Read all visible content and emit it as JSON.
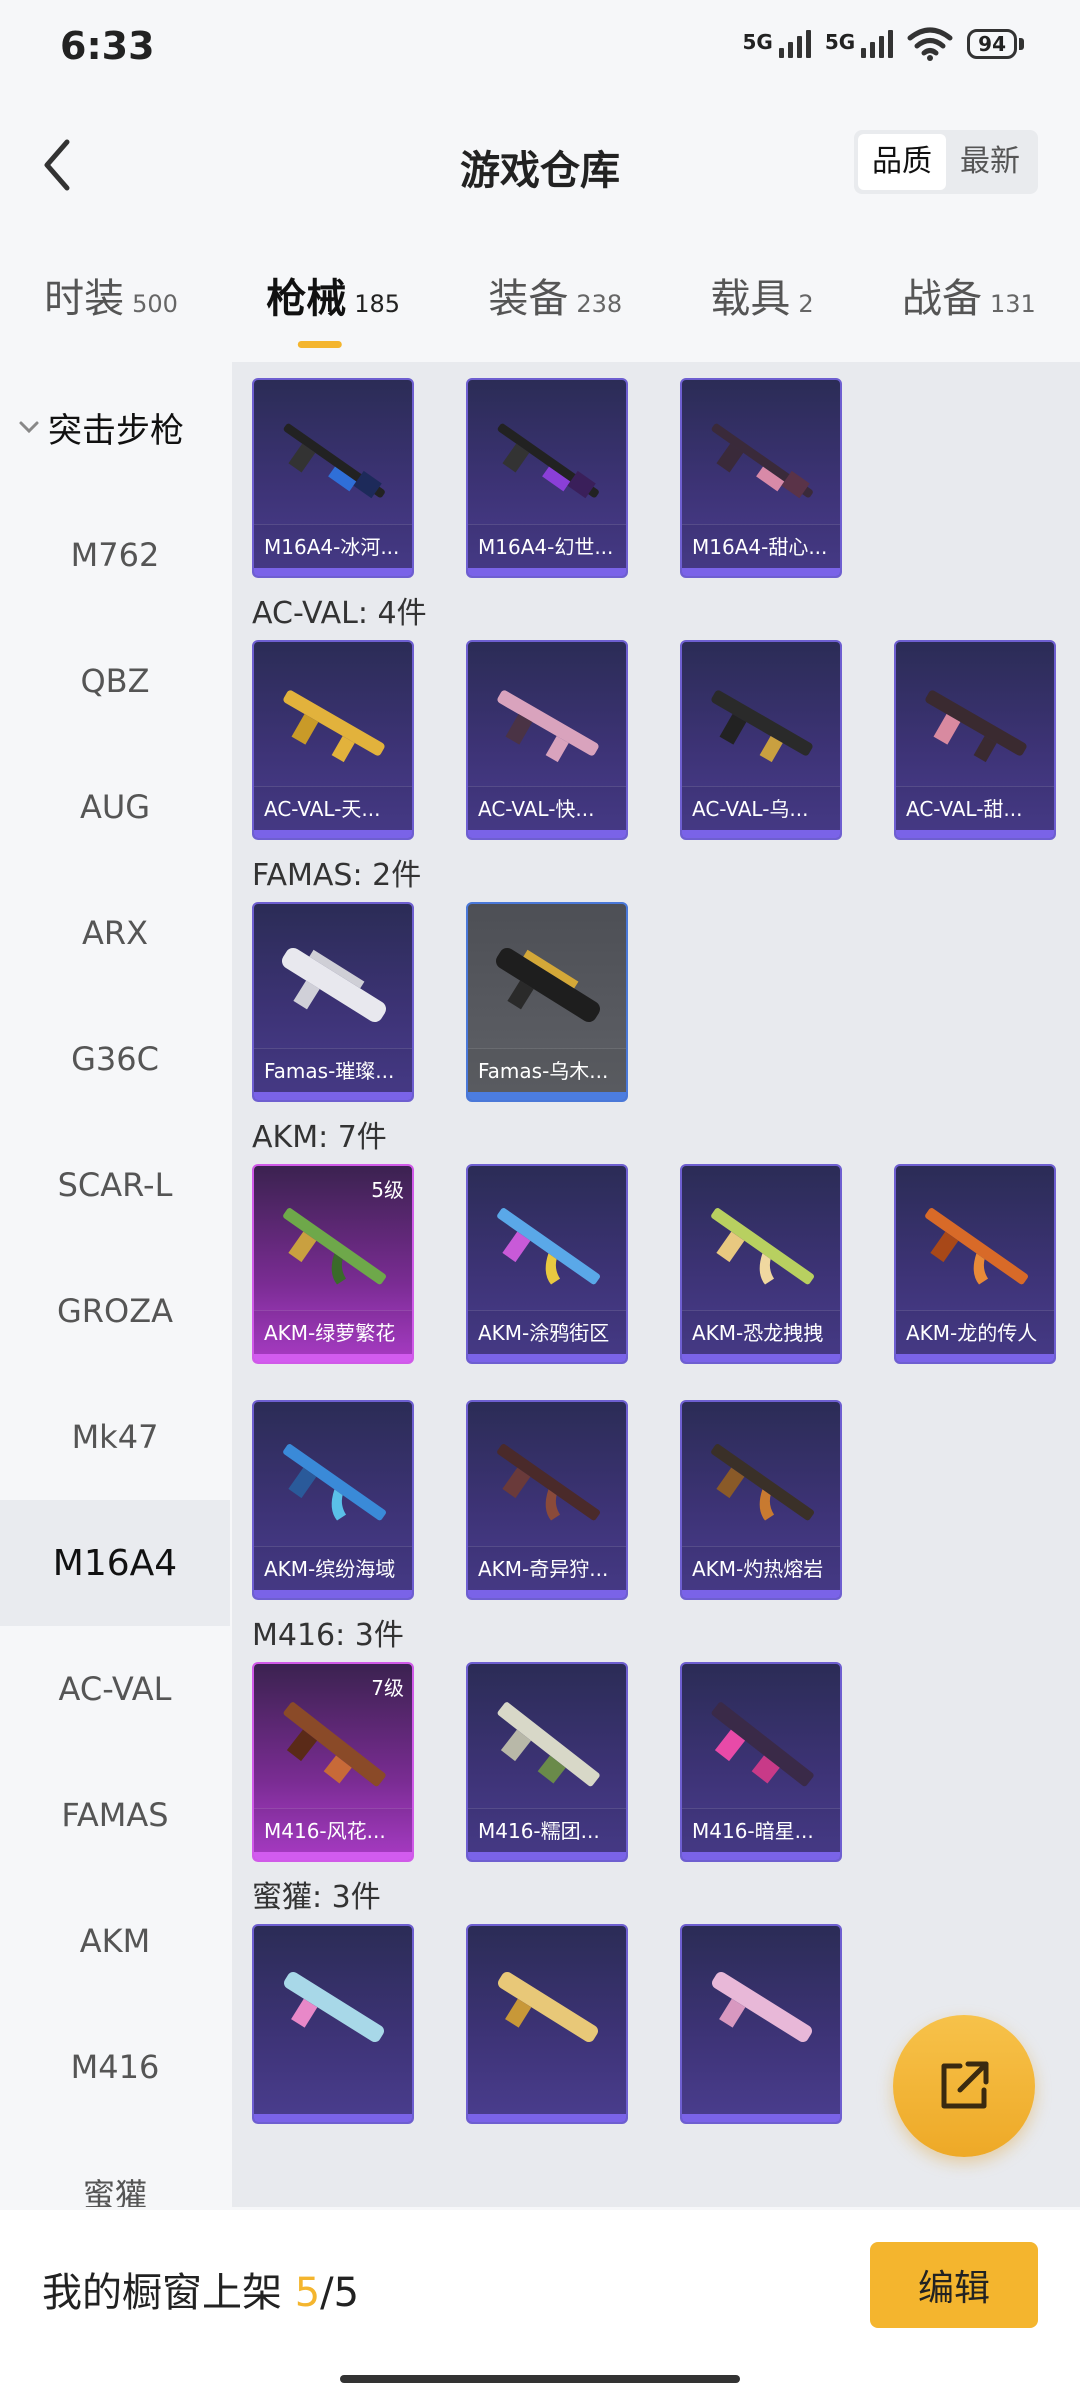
{
  "status": {
    "time": "6:33",
    "net1": "5G",
    "net2": "5G",
    "battery": "94"
  },
  "header": {
    "title": "游戏仓库",
    "sort_quality": "品质",
    "sort_latest": "最新"
  },
  "tabs": [
    {
      "label": "时装",
      "count": "500"
    },
    {
      "label": "枪械",
      "count": "185"
    },
    {
      "label": "装备",
      "count": "238"
    },
    {
      "label": "载具",
      "count": "2"
    },
    {
      "label": "战备",
      "count": "131"
    }
  ],
  "sidebar": {
    "header": "突击步枪",
    "items": [
      "M762",
      "QBZ",
      "AUG",
      "ARX",
      "G36C",
      "SCAR-L",
      "GROZA",
      "Mk47",
      "M16A4",
      "AC-VAL",
      "FAMAS",
      "AKM",
      "M416",
      "蜜獾"
    ]
  },
  "groups": {
    "m16a4": {
      "items": [
        "M16A4-冰河...",
        "M16A4-幻世...",
        "M16A4-甜心..."
      ]
    },
    "acval": {
      "title": "AC-VAL: 4件",
      "items": [
        "AC-VAL-天...",
        "AC-VAL-快...",
        "AC-VAL-乌...",
        "AC-VAL-甜..."
      ]
    },
    "famas": {
      "title": "FAMAS: 2件",
      "items": [
        "Famas-璀璨...",
        "Famas-乌木..."
      ]
    },
    "akm": {
      "title": "AKM: 7件",
      "items": [
        "AKM-绿萝繁花",
        "AKM-涂鸦街区",
        "AKM-恐龙拽拽",
        "AKM-龙的传人",
        "AKM-缤纷海域",
        "AKM-奇异狩...",
        "AKM-灼热熔岩"
      ],
      "level_first": "5级"
    },
    "m416": {
      "title": "M416: 3件",
      "items": [
        "M416-风花...",
        "M416-糯团...",
        "M416-暗星..."
      ],
      "level_first": "7级"
    },
    "honeybadger": {
      "title": "蜜獾: 3件"
    }
  },
  "bottom": {
    "showcase_label": "我的橱窗上架",
    "current": "5",
    "total": "/5",
    "edit": "编辑"
  },
  "colors": {
    "accent": "#f4b52e",
    "card_epic": "#6e5fd0",
    "card_legend": "#d05ae8"
  }
}
